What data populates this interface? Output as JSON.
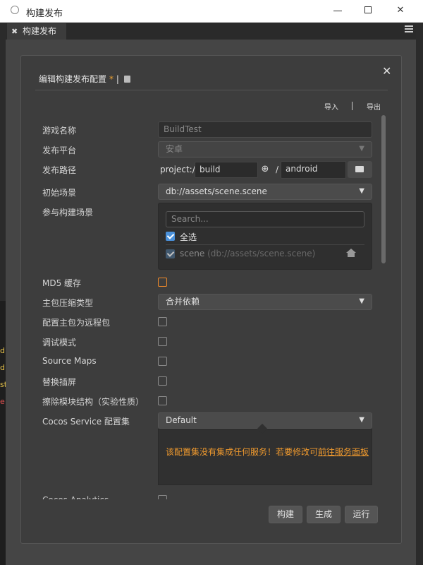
{
  "window": {
    "title": "构建发布"
  },
  "tab": {
    "label": "构建发布"
  },
  "dialog": {
    "title": "编辑构建发布配置",
    "modified_marker": "*",
    "separator": "|",
    "import_label": "导入",
    "io_separator": "|",
    "export_label": "导出"
  },
  "form": {
    "game_name": {
      "label": "游戏名称",
      "value": "BuildTest"
    },
    "platform": {
      "label": "发布平台",
      "value": "安卓"
    },
    "build_path": {
      "label": "发布路径",
      "prefix": "project://",
      "folder": "build",
      "separator": "/",
      "subfolder": "android"
    },
    "start_scene": {
      "label": "初始场景",
      "value": "db://assets/scene.scene"
    },
    "included_scenes": {
      "label": "参与构建场景",
      "search_placeholder": "Search...",
      "select_all": "全选",
      "select_all_checked": true,
      "scenes": [
        {
          "name": "scene",
          "path": "(db://assets/scene.scene)",
          "checked": true
        }
      ]
    },
    "md5_cache": {
      "label": "MD5 缓存",
      "checked": false
    },
    "main_bundle_compression": {
      "label": "主包压缩类型",
      "value": "合并依赖"
    },
    "main_bundle_remote": {
      "label": "配置主包为远程包",
      "checked": false
    },
    "debug_mode": {
      "label": "调试模式",
      "checked": false
    },
    "source_maps": {
      "label": "Source Maps",
      "checked": false
    },
    "replace_splash": {
      "label": "替换插屏",
      "checked": false
    },
    "erase_module_structure": {
      "label": "擦除模块结构（实验性质）",
      "checked": false
    },
    "cocos_service": {
      "label": "Cocos Service 配置集",
      "value": "Default",
      "notice_text": "该配置集没有集成任何服务！若要修改可",
      "notice_link": "前往服务面板"
    },
    "partial_next_label": "Cocos Analytics"
  },
  "footer": {
    "build": "构建",
    "make": "生成",
    "run": "运行"
  },
  "background_rows": [
    "d",
    "d",
    "st",
    "e"
  ],
  "colors": {
    "accent_orange": "#f09a2e",
    "checkbox_blue": "#4a90d9",
    "dialog_bg": "#3d3d3d"
  }
}
